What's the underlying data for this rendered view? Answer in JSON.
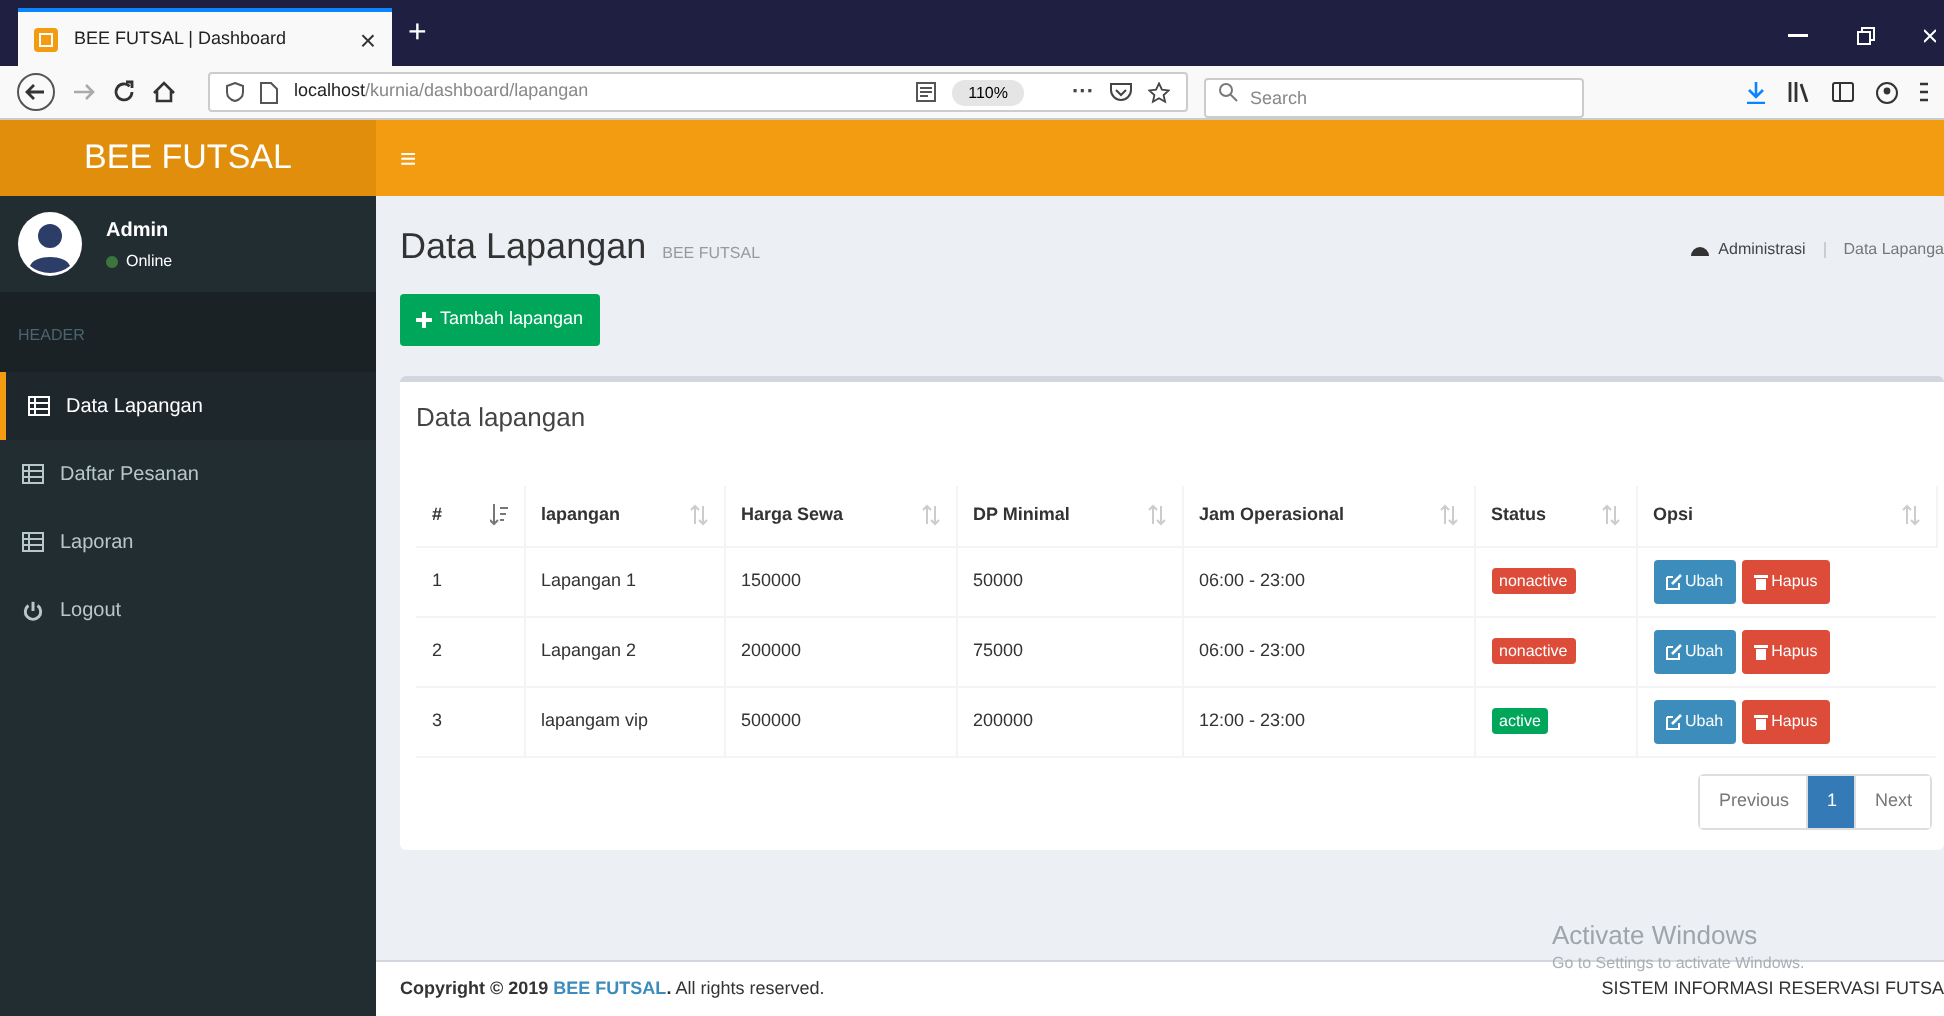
{
  "browser": {
    "tab_title": "BEE FUTSAL | Dashboard",
    "close": "×",
    "new_tab": "+",
    "url_host": "localhost",
    "url_path": "/kurnia/dashboard/lapangan",
    "zoom": "110%",
    "more": "···",
    "search_placeholder": "Search"
  },
  "header": {
    "brand": "BEE FUTSAL",
    "menu_toggle": "≡"
  },
  "sidebar": {
    "user": {
      "name": "Admin",
      "status": "Online"
    },
    "section": "HEADER",
    "items": [
      {
        "label": "Data Lapangan",
        "kind": "page",
        "selected": true
      },
      {
        "label": "Daftar Pesanan",
        "kind": "page",
        "selected": false
      },
      {
        "label": "Laporan",
        "kind": "page",
        "selected": false
      },
      {
        "label": "Logout",
        "kind": "action",
        "selected": false
      }
    ]
  },
  "page": {
    "title": "Data Lapangan",
    "subtitle": "BEE FUTSAL",
    "breadcrumb": [
      "Administrasi",
      "Data Lapanga"
    ],
    "add_button": "Tambah lapangan"
  },
  "table": {
    "title": "Data lapangan",
    "columns": [
      "#",
      "lapangan",
      "Harga Sewa",
      "DP Minimal",
      "Jam Operasional",
      "Status",
      "Opsi"
    ],
    "rows": [
      {
        "no": "1",
        "name": "Lapangan 1",
        "price": "150000",
        "dp": "50000",
        "hours": "06:00 - 23:00",
        "status": "nonactive",
        "active": false,
        "edit": "Ubah",
        "delete": "Hapus"
      },
      {
        "no": "2",
        "name": "Lapangan 2",
        "price": "200000",
        "dp": "75000",
        "hours": "06:00 - 23:00",
        "status": "nonactive",
        "active": false,
        "edit": "Ubah",
        "delete": "Hapus"
      },
      {
        "no": "3",
        "name": "lapangam vip",
        "price": "500000",
        "dp": "200000",
        "hours": "12:00 - 23:00",
        "status": "active",
        "active": true,
        "edit": "Ubah",
        "delete": "Hapus"
      }
    ],
    "pagination": [
      {
        "label": "Previous",
        "selected": false
      },
      {
        "label": "1",
        "selected": true
      },
      {
        "label": "Next",
        "selected": false
      }
    ]
  },
  "footer": {
    "copyright": "**Copyright © 2019** BEE FUTSAL**.** All rights reserved.",
    "right": "SISTEM INFORMASI RESERVASI FUTSA"
  },
  "os_notice": {
    "title": "Activate Windows",
    "text": "Go to Settings to activate Windows."
  }
}
